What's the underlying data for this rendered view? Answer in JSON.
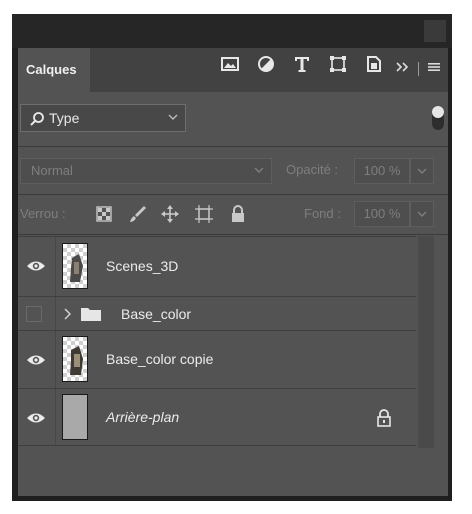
{
  "panel": {
    "tab_label": "Calques",
    "collapse_glyph": "〉〉",
    "menu_glyph": "≡"
  },
  "filter": {
    "kind_label": "Type",
    "icons": [
      "image-filter-icon",
      "adjustment-filter-icon",
      "type-filter-icon",
      "shape-filter-icon",
      "smart-object-filter-icon"
    ]
  },
  "blend": {
    "mode": "Normal",
    "opacity_label": "Opacité :",
    "opacity_value": "100 %"
  },
  "lock": {
    "label": "Verrou :",
    "fill_label": "Fond :",
    "fill_value": "100 %"
  },
  "layers": [
    {
      "name": "Scenes_3D",
      "visible": true,
      "kind": "layer"
    },
    {
      "name": "Base_color",
      "visible": false,
      "kind": "group"
    },
    {
      "name": "Base_color copie",
      "visible": true,
      "kind": "layer"
    },
    {
      "name": "Arrière-plan",
      "visible": true,
      "kind": "background",
      "locked": true
    }
  ],
  "colors": {
    "panel_bg": "#535353",
    "tab_bar": "#424242",
    "frame": "#1f1f1f"
  }
}
